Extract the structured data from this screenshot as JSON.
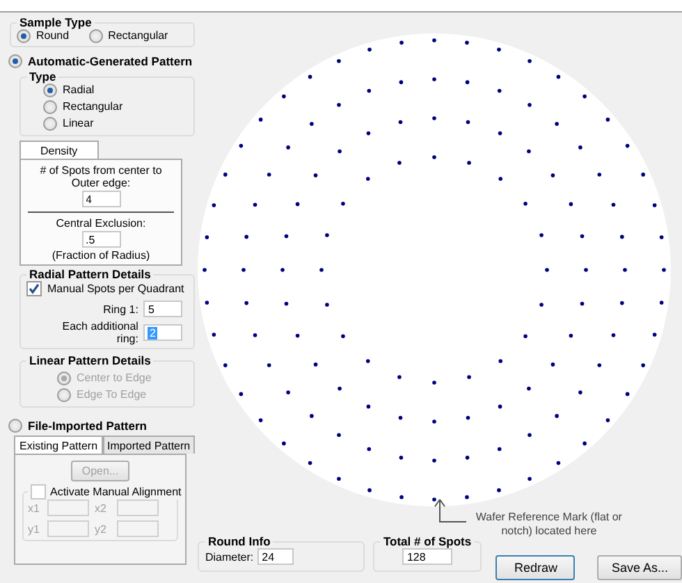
{
  "sample_type": {
    "title": "Sample Type",
    "options": [
      {
        "label": "Round",
        "selected": true
      },
      {
        "label": "Rectangular",
        "selected": false
      }
    ]
  },
  "auto_pattern": {
    "label": "Automatic-Generated Pattern",
    "selected": true,
    "type": {
      "title": "Type",
      "options": [
        {
          "label": "Radial",
          "selected": true
        },
        {
          "label": "Rectangular",
          "selected": false
        },
        {
          "label": "Linear",
          "selected": false
        }
      ]
    },
    "tabs": [
      {
        "label": "Density",
        "selected": true
      }
    ],
    "density": {
      "spots_label": "# of Spots from center to Outer edge:",
      "spots_value": "4",
      "exclusion_label": "Central Exclusion:",
      "exclusion_value": ".5",
      "exclusion_note": "(Fraction of Radius)"
    },
    "radial_details": {
      "title": "Radial Pattern Details",
      "manual": {
        "label": "Manual Spots per Quadrant",
        "checked": true
      },
      "ring1_label": "Ring 1:",
      "ring1_value": "5",
      "additional_label": "Each additional ring:",
      "additional_value": "2"
    },
    "linear_details": {
      "title": "Linear Pattern Details",
      "disabled": true,
      "options": [
        {
          "label": "Center to Edge",
          "selected": true
        },
        {
          "label": "Edge To Edge",
          "selected": false
        }
      ]
    }
  },
  "file_pattern": {
    "label": "File-Imported Pattern",
    "selected": false,
    "disabled": true,
    "tabs": [
      {
        "label": "Existing Pattern",
        "selected": true
      },
      {
        "label": "Imported Pattern",
        "selected": false
      }
    ],
    "open_button": "Open...",
    "alignment": {
      "label": "Activate Manual Alignment",
      "checked": false
    },
    "fields": [
      "x1",
      "x2",
      "y1",
      "y2"
    ]
  },
  "annotation": "Wafer Reference Mark (flat or notch) located here",
  "round_info": {
    "title": "Round Info",
    "diameter_label": "Diameter:",
    "diameter_value": "24"
  },
  "total_spots": {
    "title": "Total # of Spots",
    "value": "128"
  },
  "buttons": [
    "Redraw",
    "Save As..."
  ]
}
